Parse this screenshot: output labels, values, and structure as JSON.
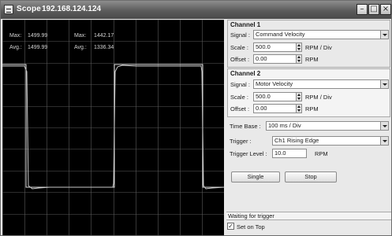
{
  "window": {
    "title": "Scope",
    "ip": "192.168.124.124"
  },
  "colors": {
    "trace": "#dcdcdc",
    "grid": "#5a5a5a",
    "screen": "#000000"
  },
  "readouts": {
    "max1_label": "Max:",
    "max1_value": "1499.99",
    "max2_label": "Max:",
    "max2_value": "1442.17",
    "avg1_label": "Avg.:",
    "avg1_value": "1499.99",
    "avg2_label": "Avg.:",
    "avg2_value": "1336.34"
  },
  "channel1": {
    "title": "Channel 1",
    "signal_label": "Signal :",
    "signal_value": "Command Velocity",
    "scale_label": "Scale :",
    "scale_value": "500.0",
    "scale_unit": "RPM / Div",
    "offset_label": "Offset :",
    "offset_value": "0.00",
    "offset_unit": "RPM"
  },
  "channel2": {
    "title": "Channel 2",
    "signal_label": "Signal :",
    "signal_value": "Motor Velocity",
    "scale_label": "Scale :",
    "scale_value": "500.0",
    "scale_unit": "RPM / Div",
    "offset_label": "Offset :",
    "offset_value": "0.00",
    "offset_unit": "RPM"
  },
  "timebase": {
    "label": "Time Base :",
    "value": "100 ms / Div"
  },
  "trigger": {
    "label": "Trigger :",
    "value": "Ch1 Rising Edge",
    "level_label": "Trigger Level :",
    "level_value": "10.0",
    "level_unit": "RPM"
  },
  "buttons": {
    "single": "Single",
    "stop": "Stop"
  },
  "status": "Waiting for trigger",
  "set_on_top": {
    "label": "Set on Top",
    "checked": true
  }
}
